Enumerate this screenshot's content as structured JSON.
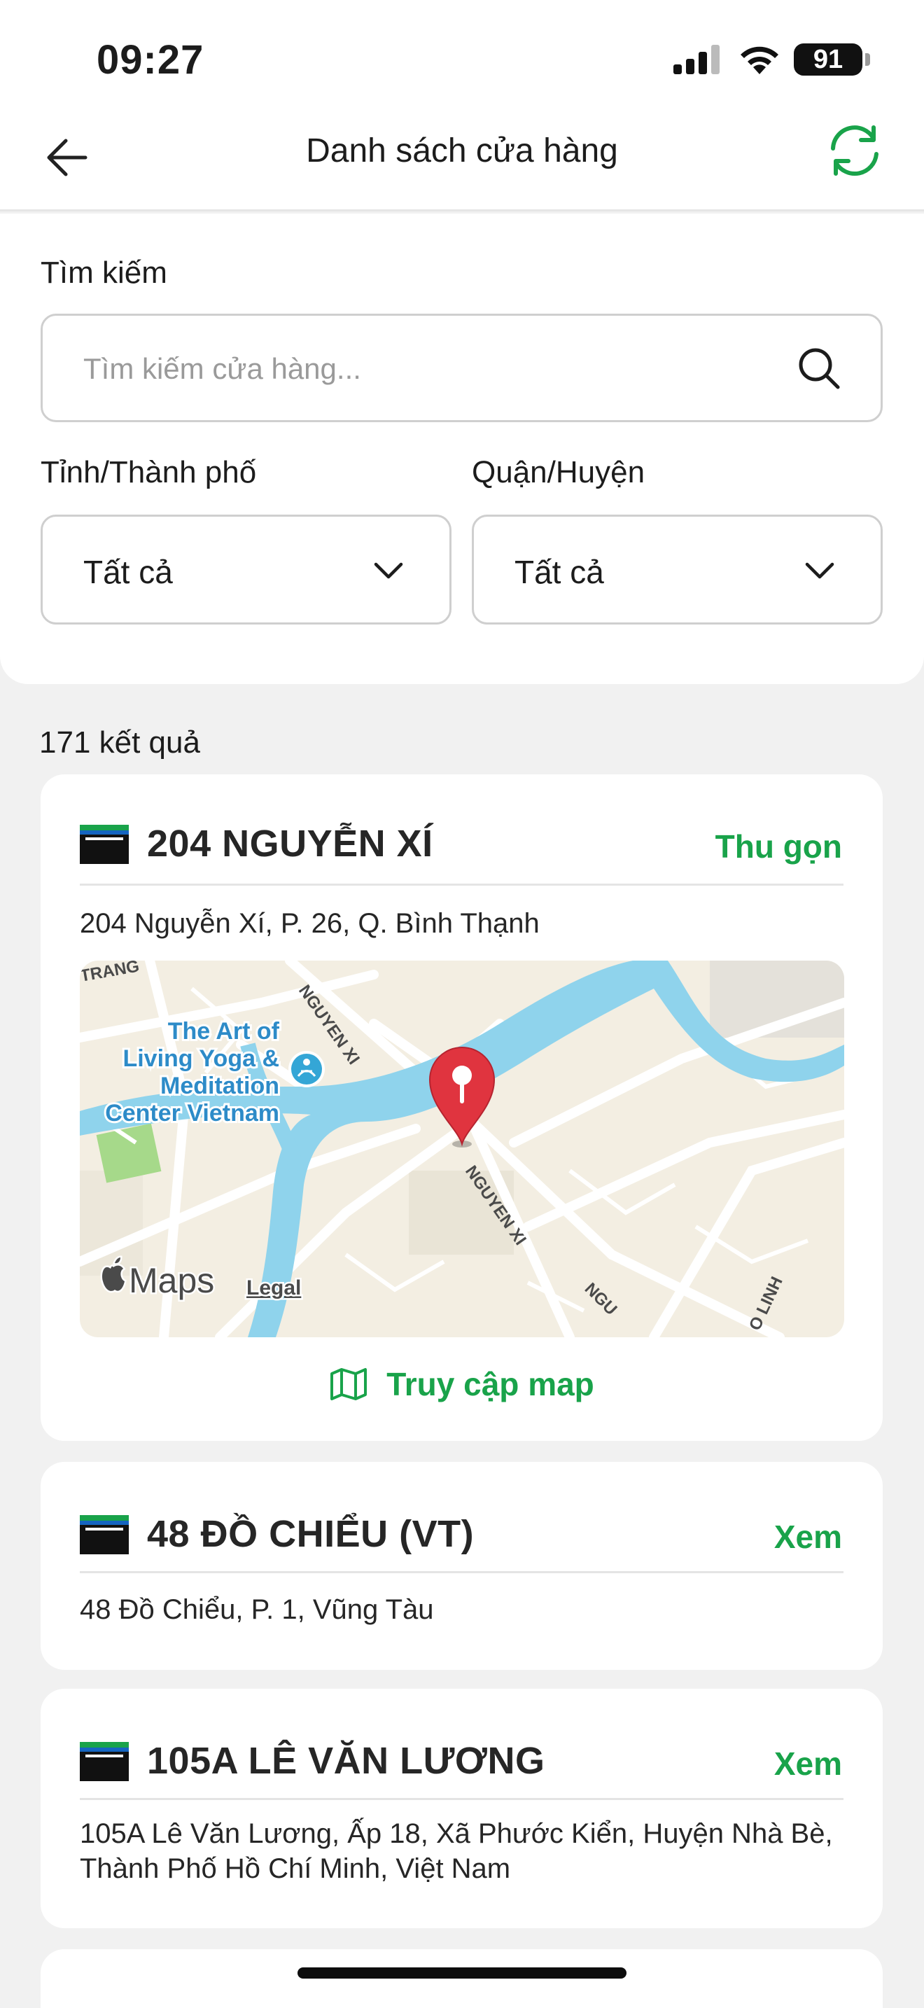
{
  "status_bar": {
    "time": "09:27",
    "battery": "91"
  },
  "nav": {
    "title": "Danh sách cửa hàng",
    "back_icon": "arrow-left-icon",
    "refresh_icon": "refresh-icon"
  },
  "filters": {
    "search_label": "Tìm kiếm",
    "search_placeholder": "Tìm kiếm cửa hàng...",
    "province_label": "Tỉnh/Thành phố",
    "province_value": "Tất cả",
    "district_label": "Quận/Huyện",
    "district_value": "Tất cả"
  },
  "results": {
    "count_text": "171 kết quả"
  },
  "stores": [
    {
      "name": "204 NGUYỄN XÍ",
      "action": "Thu gọn",
      "address": "204 Nguyễn Xí, P. 26, Q. Bình Thạnh",
      "map": {
        "poi": [
          "The Art of",
          "Living Yoga &",
          "Meditation",
          "Center Vietnam"
        ],
        "streets": [
          "TRANG",
          "NGUYEN XI",
          "NGUYEN XI",
          "NGU",
          "O LINH"
        ],
        "attribution": "Maps",
        "legal": "Legal"
      },
      "map_link": "Truy cập map"
    },
    {
      "name": "48 ĐỒ CHIỂU (VT)",
      "action": "Xem",
      "address": "48 Đồ Chiểu, P. 1, Vũng Tàu"
    },
    {
      "name": "105A LÊ VĂN LƯƠNG",
      "action": "Xem",
      "address": "105A Lê Văn Lương, Ấp 18, Xã Phước Kiển, Huyện Nhà Bè, Thành Phố Hồ Chí Minh, Việt Nam"
    }
  ],
  "colors": {
    "accent": "#19a34a",
    "water": "#8fd3ec",
    "land": "#f3eee2",
    "pin": "#e0343f"
  }
}
